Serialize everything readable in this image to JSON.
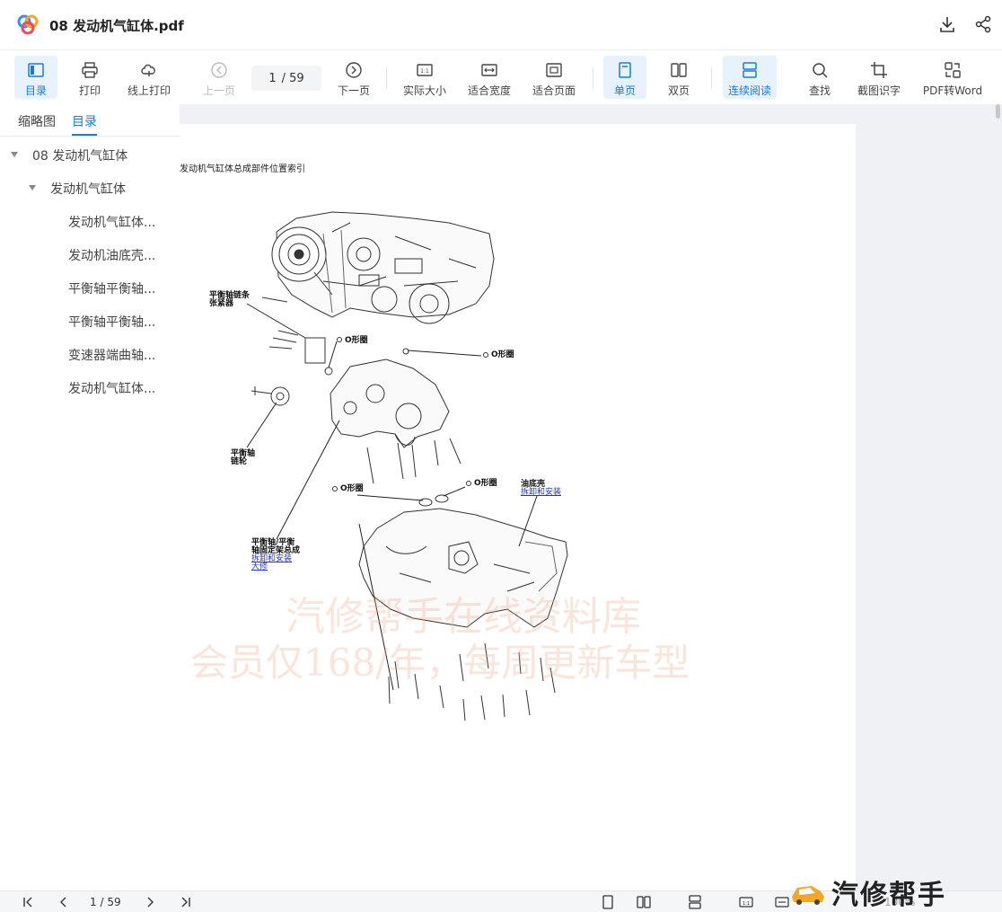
{
  "title": {
    "doc_name": "08 发动机气缸体.pdf"
  },
  "toolbar": {
    "toc": "目录",
    "print": "打印",
    "online_print": "线上打印",
    "prev_page": "上一页",
    "page_current": "1",
    "page_total": "/ 59",
    "next_page": "下一页",
    "actual_size": "实际大小",
    "fit_width": "适合宽度",
    "fit_page": "适合页面",
    "single_page": "单页",
    "double_page": "双页",
    "continuous": "连续阅读",
    "find": "查找",
    "ocr": "截图识字",
    "pdf_to_word": "PDF转Word"
  },
  "sidebar": {
    "tabs": [
      "缩略图",
      "目录"
    ],
    "toc": [
      {
        "label": "08 发动机气缸体",
        "level": 0
      },
      {
        "label": "发动机气缸体",
        "level": 1
      },
      {
        "label": "发动机气缸体...",
        "level": 2
      },
      {
        "label": "发动机油底壳...",
        "level": 2
      },
      {
        "label": "平衡轴平衡轴...",
        "level": 2
      },
      {
        "label": "平衡轴平衡轴...",
        "level": 2
      },
      {
        "label": "变速器端曲轴...",
        "level": 2
      },
      {
        "label": "发动机气缸体...",
        "level": 2
      }
    ]
  },
  "document": {
    "heading": "发动机气缸体总成部件位置索引",
    "labels": {
      "tensioner": "平衡轴链条张紧器",
      "oring1": "O形圈",
      "oring2": "O形圈",
      "oring3": "O形圈",
      "oring4": "O形圈",
      "sprocket": "平衡轴链轮",
      "oil_pan": "油底壳",
      "oil_pan_link": "拆卸和安装",
      "balancer_assy": "平衡轴/平衡轴固定架总成",
      "balancer_link": "拆卸和安装",
      "balancer_link2": "大修"
    },
    "watermark_line1": "汽修帮手在线资料库",
    "watermark_line2": "会员仅168/年，每周更新车型"
  },
  "bottombar": {
    "page_current": "1",
    "page_total": "/ 59",
    "zoom": "100%"
  },
  "brand": {
    "text": "汽修帮手"
  },
  "colors": {
    "accent": "#1a7bdc",
    "active_bg": "#e8f2fd",
    "viewer_bg": "#f0f1f4"
  }
}
